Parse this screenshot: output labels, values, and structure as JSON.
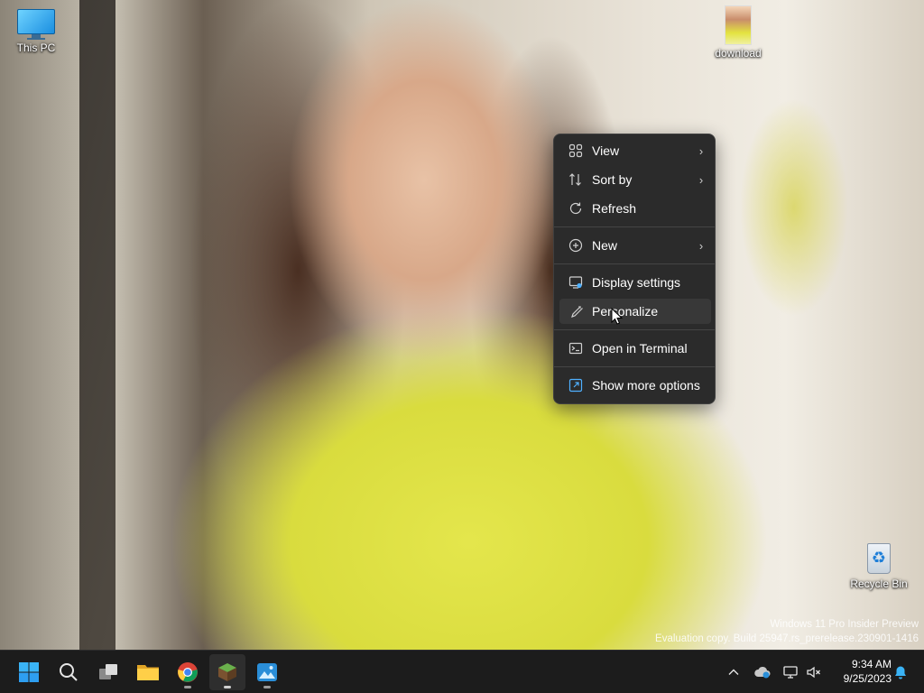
{
  "desktop": {
    "icons": [
      {
        "label": "This PC",
        "icon": "monitor-icon"
      },
      {
        "label": "download",
        "icon": "image-thumbnail-icon"
      },
      {
        "label": "Recycle Bin",
        "icon": "recycle-bin-icon"
      }
    ],
    "watermark": {
      "line1": "Windows 11 Pro Insider Preview",
      "line2": "Evaluation copy. Build 25947.rs_prerelease.230901-1416"
    }
  },
  "context_menu": {
    "items": [
      {
        "label": "View",
        "icon": "grid-view-icon",
        "submenu": true
      },
      {
        "label": "Sort by",
        "icon": "sort-icon",
        "submenu": true
      },
      {
        "label": "Refresh",
        "icon": "refresh-icon",
        "submenu": false
      },
      {
        "label": "New",
        "icon": "plus-circle-icon",
        "submenu": true
      },
      {
        "label": "Display settings",
        "icon": "display-settings-icon",
        "submenu": false
      },
      {
        "label": "Personalize",
        "icon": "brush-icon",
        "submenu": false
      },
      {
        "label": "Open in Terminal",
        "icon": "terminal-icon",
        "submenu": false
      },
      {
        "label": "Show more options",
        "icon": "more-options-icon",
        "submenu": false
      }
    ],
    "hovered": "Personalize"
  },
  "taskbar": {
    "apps": [
      {
        "name": "Start",
        "icon": "windows-start-icon"
      },
      {
        "name": "Search",
        "icon": "search-icon"
      },
      {
        "name": "Task View",
        "icon": "task-view-icon"
      },
      {
        "name": "File Explorer",
        "icon": "folder-icon"
      },
      {
        "name": "Google Chrome",
        "icon": "chrome-icon"
      },
      {
        "name": "Minecraft",
        "icon": "minecraft-icon"
      },
      {
        "name": "Photos",
        "icon": "photos-icon"
      }
    ],
    "tray": {
      "time": "9:34 AM",
      "date": "9/25/2023"
    }
  }
}
